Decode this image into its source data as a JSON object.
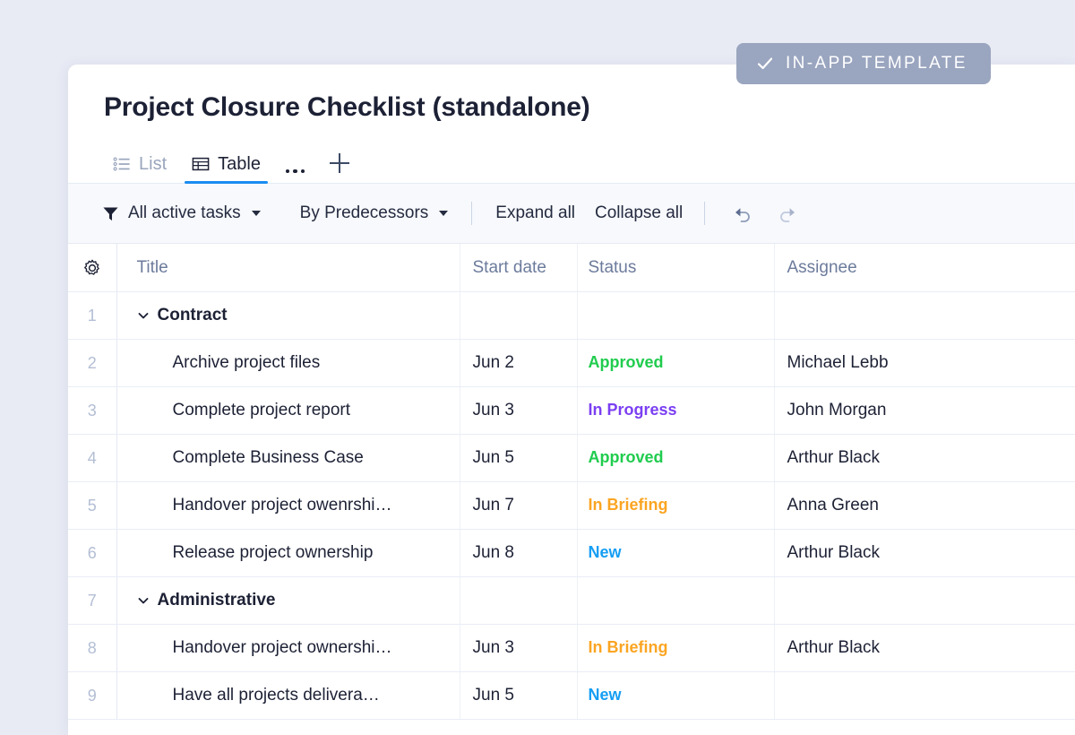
{
  "badge": {
    "label": "IN-APP TEMPLATE",
    "icon": "check-icon",
    "bg_color": "#9aa5bf",
    "text_color": "#ffffff"
  },
  "header": {
    "title": "Project Closure Checklist (standalone)"
  },
  "tabs": {
    "items": [
      {
        "label": "List",
        "icon": "list-icon",
        "active": false
      },
      {
        "label": "Table",
        "icon": "table-icon",
        "active": true
      }
    ],
    "more_icon": "ellipsis-icon",
    "add_icon": "plus-icon",
    "active_underline_color": "#1a8cf0"
  },
  "toolbar": {
    "filter_icon": "filter-icon",
    "filter_label": "All active tasks",
    "group_label": "By Predecessors",
    "expand_all_label": "Expand all",
    "collapse_all_label": "Collapse all",
    "undo_icon": "undo-arrow-icon",
    "redo_icon": "redo-arrow-icon"
  },
  "table": {
    "settings_icon": "gear-icon",
    "columns": [
      "Title",
      "Start date",
      "Status",
      "Assignee"
    ],
    "status_colors": {
      "Approved": "#20cc4e",
      "In Progress": "#7b3ff2",
      "In Briefing": "#fba522",
      "New": "#159ef3"
    },
    "rows": [
      {
        "num": "1",
        "type": "group",
        "title": "Contract",
        "start_date": "",
        "status": "",
        "assignee": ""
      },
      {
        "num": "2",
        "type": "task",
        "title": "Archive project files",
        "start_date": "Jun 2",
        "status": "Approved",
        "assignee": "Michael Lebb"
      },
      {
        "num": "3",
        "type": "task",
        "title": "Complete project report",
        "start_date": "Jun 3",
        "status": "In Progress",
        "assignee": "John Morgan"
      },
      {
        "num": "4",
        "type": "task",
        "title": "Complete Business Case",
        "start_date": "Jun 5",
        "status": "Approved",
        "assignee": "Arthur Black"
      },
      {
        "num": "5",
        "type": "task",
        "title": "Handover project owenrshi…",
        "start_date": "Jun 7",
        "status": "In Briefing",
        "assignee": "Anna Green"
      },
      {
        "num": "6",
        "type": "task",
        "title": "Release project ownership",
        "start_date": "Jun 8",
        "status": "New",
        "assignee": "Arthur Black"
      },
      {
        "num": "7",
        "type": "group",
        "title": "Administrative",
        "start_date": "",
        "status": "",
        "assignee": ""
      },
      {
        "num": "8",
        "type": "task",
        "title": "Handover project ownershi…",
        "start_date": "Jun 3",
        "status": "In Briefing",
        "assignee": "Arthur Black"
      },
      {
        "num": "9",
        "type": "task",
        "title": "Have all projects delivera…",
        "start_date": "Jun 5",
        "status": "New",
        "assignee": ""
      }
    ]
  }
}
